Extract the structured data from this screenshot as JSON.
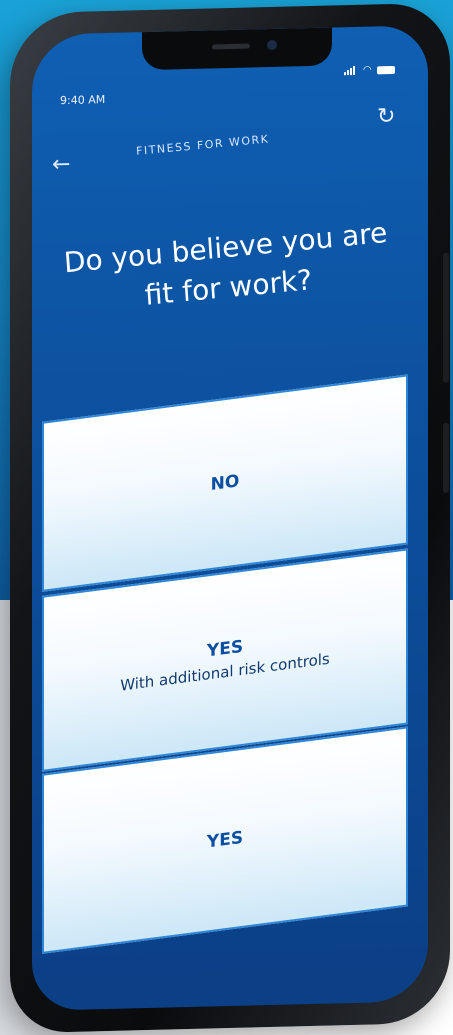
{
  "status": {
    "time": "9:40 AM"
  },
  "header": {
    "title": "FITNESS FOR WORK",
    "back_icon": "arrow-left-icon",
    "refresh_icon": "refresh-icon"
  },
  "question": {
    "text": "Do you believe you are fit for work?"
  },
  "options": [
    {
      "label": "NO",
      "sub": ""
    },
    {
      "label": "YES",
      "sub": "With additional risk controls"
    },
    {
      "label": "YES",
      "sub": ""
    }
  ],
  "colors": {
    "accent": "#0c4ea0",
    "screen_bg": "#0f5fb3",
    "option_bg": "#eef7fd"
  }
}
